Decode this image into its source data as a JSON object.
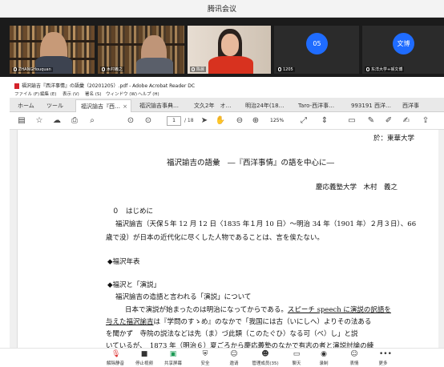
{
  "meeting": {
    "title": "腾讯会议",
    "participants": [
      {
        "name": "ZHANGHouquan",
        "kind": "video"
      },
      {
        "name": "木村義之",
        "kind": "video"
      },
      {
        "name": "陈晨",
        "kind": "video"
      },
      {
        "name": "1205",
        "kind": "avatar",
        "avatar_text": "05"
      },
      {
        "name": "东洋大学+孫文博",
        "kind": "avatar",
        "avatar_text": "文博"
      }
    ],
    "controls": [
      {
        "label": "解除静音",
        "icon": "mic-muted-icon"
      },
      {
        "label": "停止视频",
        "icon": "video-icon"
      },
      {
        "label": "共享屏幕",
        "icon": "share-screen-icon"
      },
      {
        "label": "安全",
        "icon": "shield-icon"
      },
      {
        "label": "邀请",
        "icon": "invite-icon"
      },
      {
        "label": "管理成员(35)",
        "icon": "members-icon"
      },
      {
        "label": "聊天",
        "icon": "chat-icon"
      },
      {
        "label": "录制",
        "icon": "record-icon"
      },
      {
        "label": "表情",
        "icon": "emoji-icon"
      },
      {
        "label": "更多",
        "icon": "more-icon"
      }
    ]
  },
  "acrobat": {
    "window_title": "福沢諭吉『西洋事情』の語彙（20201205）.pdf - Adobe Acrobat Reader DC",
    "menu": [
      "ファイル (F)",
      "編集 (E)",
      "表示 (V)",
      "署名 (S)",
      "ウィンドウ (W)",
      "ヘルプ (H)"
    ],
    "tabs": [
      {
        "label": "ホーム"
      },
      {
        "label": "ツール"
      },
      {
        "label": "福沢諭吉『西…",
        "active": true
      },
      {
        "label": "福沢諭吉事典…"
      },
      {
        "label": "文久2年　オ…"
      },
      {
        "label": "明治24年(18…"
      },
      {
        "label": "Taro-西洋事…"
      },
      {
        "label": "993191 西洋…"
      },
      {
        "label": "西洋事"
      }
    ],
    "page_current": "1",
    "page_total": "/ 18",
    "zoom": "125%"
  },
  "document": {
    "header_right": "於：東華大学",
    "title": "福沢諭吉の語彙　―『西洋事情』の語を中心に―",
    "author": "慶応義塾大学　木村　義之",
    "sec0_heading": "０　はじめに",
    "sec0_line1": "福沢諭吉（天保５年 12 月 12 日〈1835 年１月 10 日〉～明治 34 年（1901 年）２月３日）、66",
    "sec0_line2": "歳で没）が日本の近代化に尽くした人物であることは、言を俟たない。",
    "heading_chronology": "◆福沢年表",
    "heading_speech": "◆福沢と「演説」",
    "speech_line1": "福沢諭吉の造語と言われる「演説」について",
    "speech_line2_a": "日本で演説が始まったのは明治になってからである。",
    "speech_line2_b": "スピーチ speech に演説の訳語を",
    "speech_line3_a": "与えた福沢諭吉",
    "speech_line3_b": "は『学問のすゝめ』のなかで「我国には古（いにしへ）よりその法ある",
    "speech_line4": "を聞かず　寺院の説法などは先（ま）づ此類（このたぐひ）なる可（べ）し」と説",
    "speech_line5": "いているが、　1873 年（明治６）夏ごろから慶応義塾のなかで有志の者と演説討論の練"
  }
}
